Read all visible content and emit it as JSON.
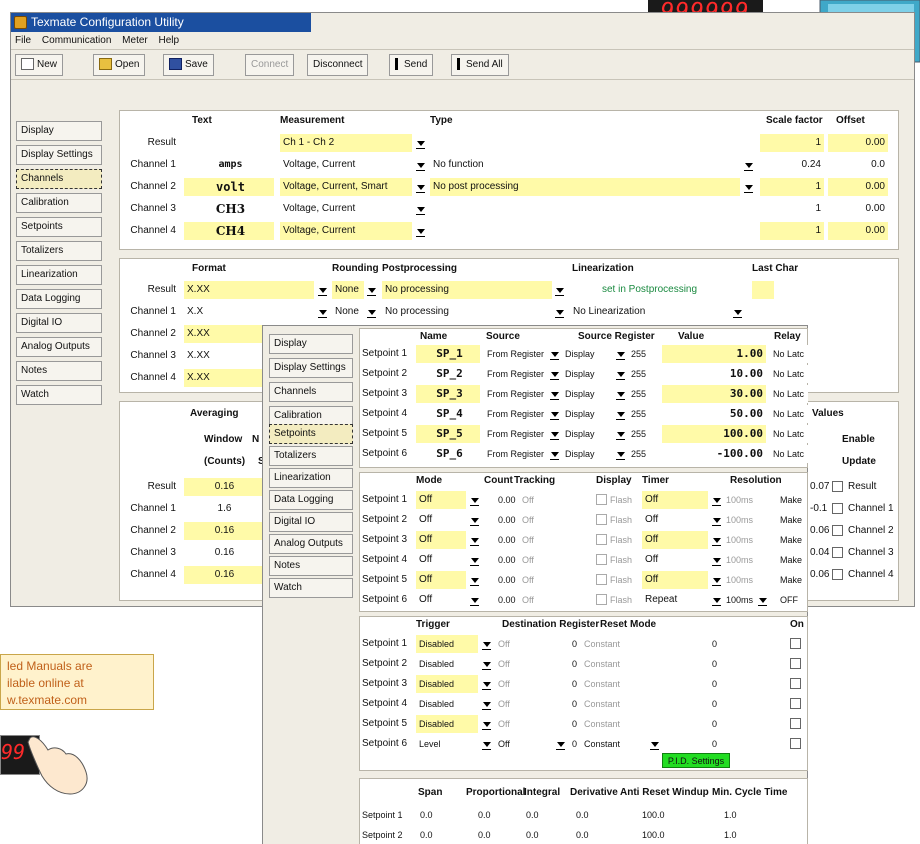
{
  "main": {
    "title": "Texmate Configuration Utility",
    "menu": [
      "File",
      "Communication",
      "Meter",
      "Help"
    ],
    "toolbar": {
      "new": "New",
      "open": "Open",
      "save": "Save",
      "connect": "Connect",
      "disconnect": "Disconnect",
      "send": "Send",
      "send_all": "Send All"
    },
    "nav": [
      "Display",
      "Display Settings",
      "Channels",
      "Calibration",
      "Setpoints",
      "Totalizers",
      "Linearization",
      "Data Logging",
      "Digital IO",
      "Analog Outputs",
      "Notes",
      "Watch"
    ],
    "nav_selected": "Channels",
    "table1": {
      "headers": {
        "text": "Text",
        "measurement": "Measurement",
        "type": "Type",
        "scale": "Scale factor",
        "offset": "Offset"
      },
      "rows": [
        {
          "label": "Result",
          "text": "",
          "measurement": "Ch 1 - Ch 2",
          "type": "",
          "scale": "1",
          "offset": "0.00"
        },
        {
          "label": "Channel 1",
          "text": "amps",
          "measurement": "Voltage, Current",
          "type": "No function",
          "scale": "0.24",
          "offset": "0.0"
        },
        {
          "label": "Channel 2",
          "text": "volt",
          "measurement": "Voltage, Current, Smart",
          "type": "No post processing",
          "scale": "1",
          "offset": "0.00"
        },
        {
          "label": "Channel 3",
          "text": "CH3",
          "measurement": "Voltage, Current",
          "type": "",
          "scale": "1",
          "offset": "0.00"
        },
        {
          "label": "Channel 4",
          "text": "CH4",
          "measurement": "Voltage, Current",
          "type": "",
          "scale": "1",
          "offset": "0.00"
        }
      ]
    },
    "table2": {
      "headers": {
        "format": "Format",
        "rounding": "Rounding",
        "post": "Postprocessing",
        "lin": "Linearization",
        "last": "Last Char"
      },
      "rows": [
        {
          "label": "Result",
          "format": "X.XX",
          "rounding": "None",
          "post": "No processing",
          "lin": "set in Postprocessing"
        },
        {
          "label": "Channel 1",
          "format": "X.X",
          "rounding": "None",
          "post": "No processing",
          "lin": "No Linearization"
        },
        {
          "label": "Channel 2",
          "format": "X.XX"
        },
        {
          "label": "Channel 3",
          "format": "X.XX"
        },
        {
          "label": "Channel 4",
          "format": "X.XX"
        }
      ]
    },
    "averaging": {
      "title": "Averaging",
      "window": "Window",
      "counts": "(Counts)",
      "n": "N",
      "s": "S",
      "rows": [
        {
          "label": "Result",
          "value": "0.16"
        },
        {
          "label": "Channel 1",
          "value": "1.6"
        },
        {
          "label": "Channel 2",
          "value": "0.16"
        },
        {
          "label": "Channel 3",
          "value": "0.16"
        },
        {
          "label": "Channel 4",
          "value": "0.16"
        }
      ]
    },
    "values": {
      "title": "Values",
      "enable": "Enable",
      "update": "Update",
      "rows": [
        {
          "num": "0.07",
          "label": "Result"
        },
        {
          "num": "-0.1",
          "label": "Channel 1"
        },
        {
          "num": "0.06",
          "label": "Channel 2"
        },
        {
          "num": "0.04",
          "label": "Channel 3"
        },
        {
          "num": "0.06",
          "label": "Channel 4"
        }
      ]
    }
  },
  "meter_display": "999999",
  "note": [
    "led Manuals are",
    "ilable online at",
    "w.texmate.com"
  ],
  "small_meter_digits": "99",
  "setpoint_win": {
    "nav": [
      "Display",
      "Display Settings",
      "Channels",
      "Calibration",
      "Setpoints",
      "Totalizers",
      "Linearization",
      "Data Logging",
      "Digital IO",
      "Analog Outputs",
      "Notes",
      "Watch"
    ],
    "nav_selected": "Setpoints",
    "t1_headers": {
      "name": "Name",
      "source": "Source",
      "source_reg": "Source Register",
      "value": "Value",
      "relay": "Relay"
    },
    "t1_rows": [
      {
        "label": "Setpoint 1",
        "name": "SP_1",
        "source": "From Register",
        "reg": "Display",
        "regnum": "255",
        "value": "1.00",
        "relay": "No Latc"
      },
      {
        "label": "Setpoint 2",
        "name": "SP_2",
        "source": "From Register",
        "reg": "Display",
        "regnum": "255",
        "value": "10.00",
        "relay": "No Latc"
      },
      {
        "label": "Setpoint 3",
        "name": "SP_3",
        "source": "From Register",
        "reg": "Display",
        "regnum": "255",
        "value": "30.00",
        "relay": "No Latc"
      },
      {
        "label": "Setpoint 4",
        "name": "SP_4",
        "source": "From Register",
        "reg": "Display",
        "regnum": "255",
        "value": "50.00",
        "relay": "No Latc"
      },
      {
        "label": "Setpoint 5",
        "name": "SP_5",
        "source": "From Register",
        "reg": "Display",
        "regnum": "255",
        "value": "100.00",
        "relay": "No Latc"
      },
      {
        "label": "Setpoint 6",
        "name": "SP_6",
        "source": "From Register",
        "reg": "Display",
        "regnum": "255",
        "value": "-100.00",
        "relay": "No Latc"
      }
    ],
    "t2_headers": {
      "mode": "Mode",
      "count": "Count",
      "tracking": "Tracking",
      "display": "Display",
      "timer": "Timer",
      "resolution": "Resolution"
    },
    "t2_rows": [
      {
        "label": "Setpoint 1",
        "mode": "Off",
        "count": "0.00",
        "tracking": "Off",
        "display": "Flash",
        "timer": "Off",
        "res": "100ms",
        "extra": "Make"
      },
      {
        "label": "Setpoint 2",
        "mode": "Off",
        "count": "0.00",
        "tracking": "Off",
        "display": "Flash",
        "timer": "Off",
        "res": "100ms",
        "extra": "Make"
      },
      {
        "label": "Setpoint 3",
        "mode": "Off",
        "count": "0.00",
        "tracking": "Off",
        "display": "Flash",
        "timer": "Off",
        "res": "100ms",
        "extra": "Make"
      },
      {
        "label": "Setpoint 4",
        "mode": "Off",
        "count": "0.00",
        "tracking": "Off",
        "display": "Flash",
        "timer": "Off",
        "res": "100ms",
        "extra": "Make"
      },
      {
        "label": "Setpoint 5",
        "mode": "Off",
        "count": "0.00",
        "tracking": "Off",
        "display": "Flash",
        "timer": "Off",
        "res": "100ms",
        "extra": "Make"
      },
      {
        "label": "Setpoint 6",
        "mode": "Off",
        "count": "0.00",
        "tracking": "Off",
        "display": "Flash",
        "timer": "Repeat",
        "res": "100ms",
        "extra": "OFF"
      }
    ],
    "t3_headers": {
      "trigger": "Trigger",
      "dest": "Destination Register",
      "reset": "Reset Mode",
      "on": "On"
    },
    "t3_rows": [
      {
        "label": "Setpoint 1",
        "trigger": "Disabled",
        "dest": "Off",
        "num": "0",
        "reset": "Constant",
        "val": "0"
      },
      {
        "label": "Setpoint 2",
        "trigger": "Disabled",
        "dest": "Off",
        "num": "0",
        "reset": "Constant",
        "val": "0"
      },
      {
        "label": "Setpoint 3",
        "trigger": "Disabled",
        "dest": "Off",
        "num": "0",
        "reset": "Constant",
        "val": "0"
      },
      {
        "label": "Setpoint 4",
        "trigger": "Disabled",
        "dest": "Off",
        "num": "0",
        "reset": "Constant",
        "val": "0"
      },
      {
        "label": "Setpoint 5",
        "trigger": "Disabled",
        "dest": "Off",
        "num": "0",
        "reset": "Constant",
        "val": "0"
      },
      {
        "label": "Setpoint 6",
        "trigger": "Level",
        "dest": "Off",
        "num": "0",
        "reset": "Constant",
        "val": "0"
      }
    ],
    "pid_button": "P.I.D. Settings",
    "t4_headers": {
      "span": "Span",
      "prop": "Proportional",
      "integral": "Integral",
      "deriv": "Derivative",
      "windup": "Anti Reset Windup",
      "cycle": "Min. Cycle Time"
    },
    "t4_rows": [
      {
        "label": "Setpoint 1",
        "span": "0.0",
        "prop": "0.0",
        "integral": "0.0",
        "deriv": "0.0",
        "windup": "100.0",
        "cycle": "1.0"
      },
      {
        "label": "Setpoint 2",
        "span": "0.0",
        "prop": "0.0",
        "integral": "0.0",
        "deriv": "0.0",
        "windup": "100.0",
        "cycle": "1.0"
      }
    ]
  }
}
